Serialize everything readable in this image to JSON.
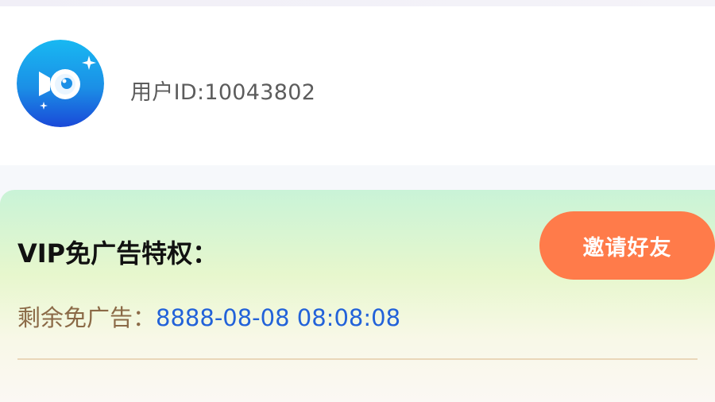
{
  "profile": {
    "user_id": "用户ID:10043802",
    "avatar_icon": "app-logo-icon"
  },
  "vip": {
    "title": "VIP免广告特权：",
    "invite_label": "邀请好友",
    "remain_label": "剩余免广告：",
    "remain_value": "8888-08-08 08:08:08"
  },
  "colors": {
    "accent": "#ff7b4a",
    "link_blue": "#2262d9",
    "label_brown": "#8b6a47",
    "avatar_blue": "#1b8fe6"
  }
}
